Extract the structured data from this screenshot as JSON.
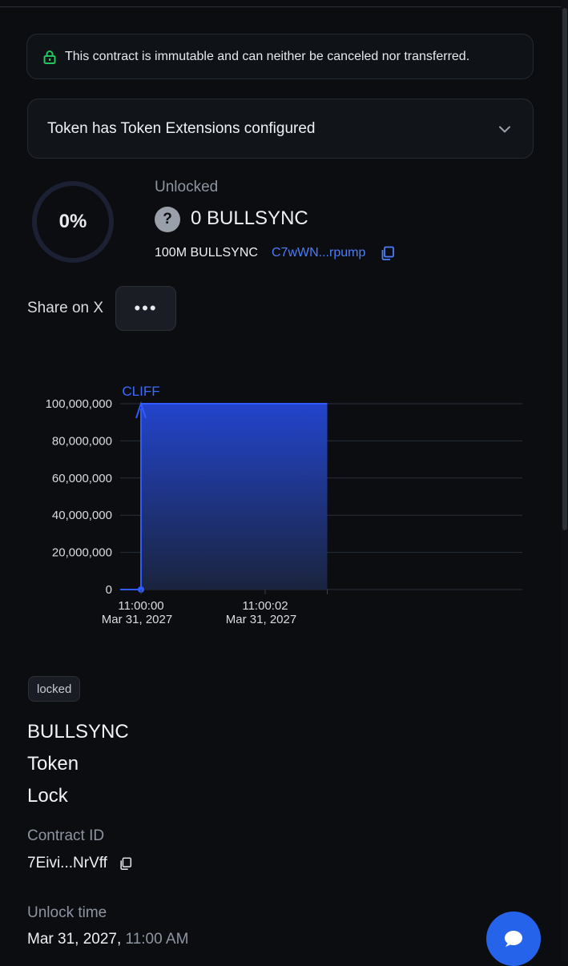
{
  "notice": {
    "text": "This contract is immutable and can neither be canceled nor transferred.",
    "icon": "lock-icon",
    "icon_color": "#22c55e"
  },
  "extensions": {
    "label": "Token has Token Extensions configured",
    "icon": "chevron-down-icon"
  },
  "progress": {
    "percent_label": "0%",
    "fraction": 0
  },
  "unlocked": {
    "label": "Unlocked",
    "amount": "0 BULLSYNC",
    "total": "100M BULLSYNC",
    "mint_short": "C7wWN...rpump",
    "link_color": "#4d7ef7"
  },
  "share": {
    "label": "Share on X",
    "more_label": "•••"
  },
  "chart_data": {
    "type": "area",
    "annotation": "CLIFF",
    "y_ticks": [
      "100,000,000",
      "80,000,000",
      "60,000,000",
      "40,000,000",
      "20,000,000",
      "0"
    ],
    "ylim": [
      0,
      100000000
    ],
    "x_ticks": [
      {
        "time": "11:00:00",
        "date": "Mar 31, 2027"
      },
      {
        "time": "11:00:02",
        "date": "Mar 31, 2027"
      }
    ],
    "series": [
      {
        "values": [
          {
            "x": "11:00:00",
            "y": 0
          },
          {
            "x": "11:00:00",
            "y": 100000000
          },
          {
            "x": "11:00:03",
            "y": 100000000
          }
        ]
      }
    ],
    "grid": true,
    "accent": "#2f5bff"
  },
  "details": {
    "badge": "locked",
    "title_lines": [
      "BULLSYNC",
      "Token",
      "Lock"
    ],
    "contract_label": "Contract ID",
    "contract_id": "7Eivi...NrVff",
    "unlock_label": "Unlock time",
    "unlock_date": "Mar 31, 2027,",
    "unlock_time": "11:00 AM"
  },
  "chat": {
    "icon": "chat-bubble-icon"
  }
}
